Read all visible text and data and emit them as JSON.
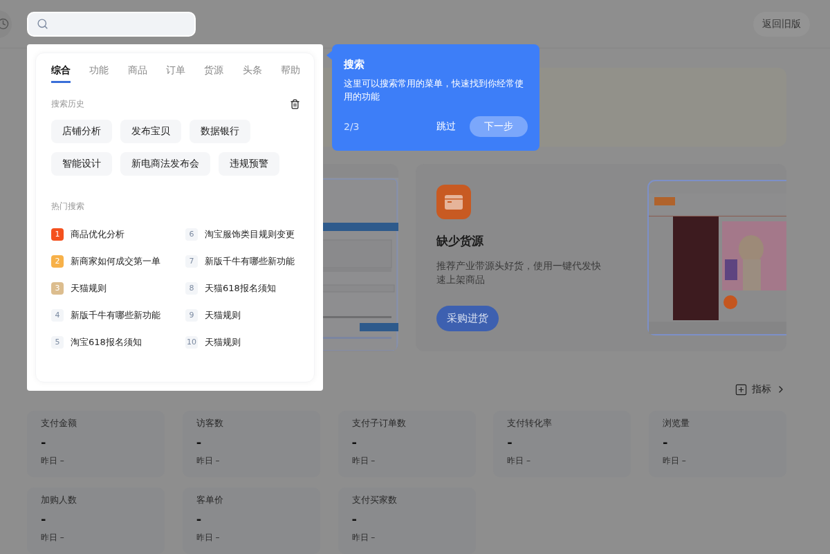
{
  "topbar": {
    "back_button": "返回旧版"
  },
  "search": {
    "tabs": [
      {
        "label": "综合",
        "selected": true
      },
      {
        "label": "功能",
        "selected": false
      },
      {
        "label": "商品",
        "selected": false
      },
      {
        "label": "订单",
        "selected": false
      },
      {
        "label": "货源",
        "selected": false
      },
      {
        "label": "头条",
        "selected": false
      },
      {
        "label": "帮助",
        "selected": false
      }
    ],
    "history_title": "搜索历史",
    "history": [
      "店铺分析",
      "发布宝贝",
      "数据银行",
      "智能设计",
      "新电商法发布会",
      "违规预警"
    ],
    "hot_title": "热门搜索",
    "hot": [
      {
        "rank": "1",
        "text": "商品优化分析",
        "kind": "top",
        "color": "#f4511e"
      },
      {
        "rank": "2",
        "text": "新商家如何成交第一单",
        "kind": "top",
        "color": "#f7b149"
      },
      {
        "rank": "3",
        "text": "天猫规则",
        "kind": "top",
        "color": "#dcbd8e"
      },
      {
        "rank": "4",
        "text": "新版千牛有哪些新功能",
        "kind": "plain"
      },
      {
        "rank": "5",
        "text": "淘宝618报名须知",
        "kind": "plain"
      },
      {
        "rank": "6",
        "text": "淘宝服饰类目规则变更",
        "kind": "plain"
      },
      {
        "rank": "7",
        "text": "新版千牛有哪些新功能",
        "kind": "plain"
      },
      {
        "rank": "8",
        "text": "天猫618报名须知",
        "kind": "plain"
      },
      {
        "rank": "9",
        "text": "天猫规则",
        "kind": "plain"
      },
      {
        "rank": "10",
        "text": "天猫规则",
        "kind": "plain"
      }
    ]
  },
  "guide": {
    "title": "搜索",
    "text": "这里可以搜索常用的菜单，快速找到你经常使用的功能",
    "step": "2/3",
    "skip": "跳过",
    "next": "下一步"
  },
  "cards": [
    {
      "kind": "picture"
    },
    {
      "kind": "promo",
      "title": "缺少货源",
      "text": "推荐产业带源头好货，使用一键代发快速上架商品",
      "button": "采购进货"
    }
  ],
  "metrics_link": "指标",
  "metrics": [
    {
      "label": "支付金额",
      "value": "-",
      "compare": "昨日 –"
    },
    {
      "label": "访客数",
      "value": "-",
      "compare": "昨日 –"
    },
    {
      "label": "支付子订单数",
      "value": "-",
      "compare": "昨日 –"
    },
    {
      "label": "支付转化率",
      "value": "-",
      "compare": "昨日 –"
    },
    {
      "label": "浏览量",
      "value": "-",
      "compare": "昨日 –"
    },
    {
      "label": "加购人数",
      "value": "-",
      "compare": "昨日 –"
    },
    {
      "label": "客单价",
      "value": "-",
      "compare": "昨日 –"
    },
    {
      "label": "支付买家数",
      "value": "-",
      "compare": "昨日 –"
    }
  ]
}
